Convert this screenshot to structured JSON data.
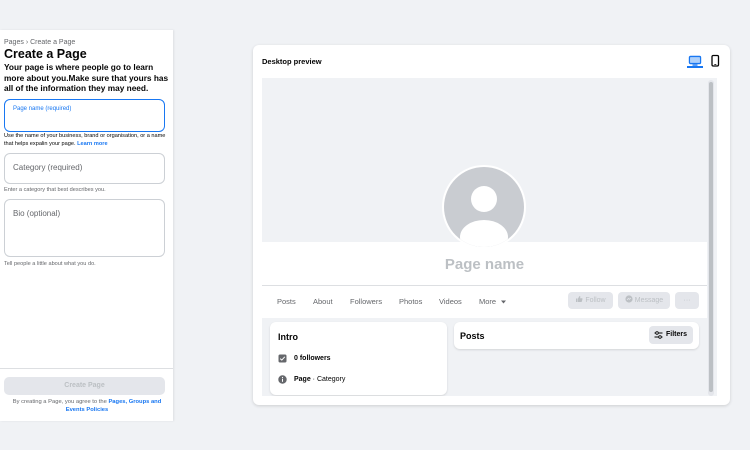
{
  "sidebar": {
    "breadcrumb_parent": "Pages",
    "breadcrumb_sep": "›",
    "breadcrumb_current": "Create a Page",
    "heading": "Create a Page",
    "description": "Your page is where people go to learn more about you.Make sure that yours has all of the information they may need.",
    "name_field": {
      "label": "Page name (required)",
      "value": ""
    },
    "name_helper": "Use the name of your business, brand or organisation, or a name that helps expalin your page.",
    "name_helper_link": "Learn more",
    "category_field": {
      "placeholder": "Category (required)"
    },
    "category_helper": "Enter a category that best describes you.",
    "bio_field": {
      "placeholder": "Bio (optional)"
    },
    "bio_helper": "Tell people a little about what you do.",
    "create_button": "Create Page",
    "terms_prefix": "By creating a Page, you agree to the",
    "terms_link": "Pages, Groups and Events Policies"
  },
  "preview": {
    "title": "Desktop preview",
    "page_name": "Page name",
    "tabs": [
      "Posts",
      "About",
      "Followers",
      "Photos",
      "Videos",
      "More"
    ],
    "follow_label": "Follow",
    "message_label": "Message",
    "more_actions_label": "···",
    "intro_title": "Intro",
    "followers_text": "0 followers",
    "page_label": "Page",
    "category_suffix": " · Category",
    "posts_title": "Posts",
    "filters_label": "Filters"
  },
  "colors": {
    "accent": "#1877f2",
    "background": "#f0f2f5",
    "disabled": "#e4e6eb"
  },
  "icons": [
    "desktop-icon",
    "mobile-icon",
    "avatar-silhouette",
    "like-icon",
    "messenger-icon",
    "followers-icon",
    "info-icon",
    "filters-icon",
    "caret-down-icon"
  ]
}
